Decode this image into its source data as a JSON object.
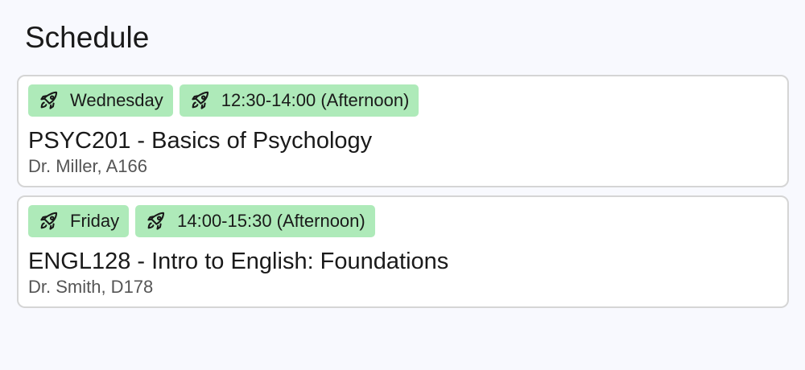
{
  "page": {
    "title": "Schedule"
  },
  "courses": [
    {
      "day": "Wednesday",
      "time": "12:30-14:00 (Afternoon)",
      "title": "PSYC201 - Basics of Psychology",
      "meta": "Dr. Miller, A166",
      "tag_icon": "rocket-icon"
    },
    {
      "day": "Friday",
      "time": "14:00-15:30 (Afternoon)",
      "title": "ENGL128 - Intro to English: Foundations",
      "meta": "Dr. Smith, D178",
      "tag_icon": "rocket-icon"
    }
  ],
  "colors": {
    "background": "#f8f9fe",
    "card_background": "#ffffff",
    "card_border": "#d5d5d5",
    "tag_background": "#aeeab9",
    "text_primary": "#1a1a1a",
    "text_secondary": "#555555"
  }
}
